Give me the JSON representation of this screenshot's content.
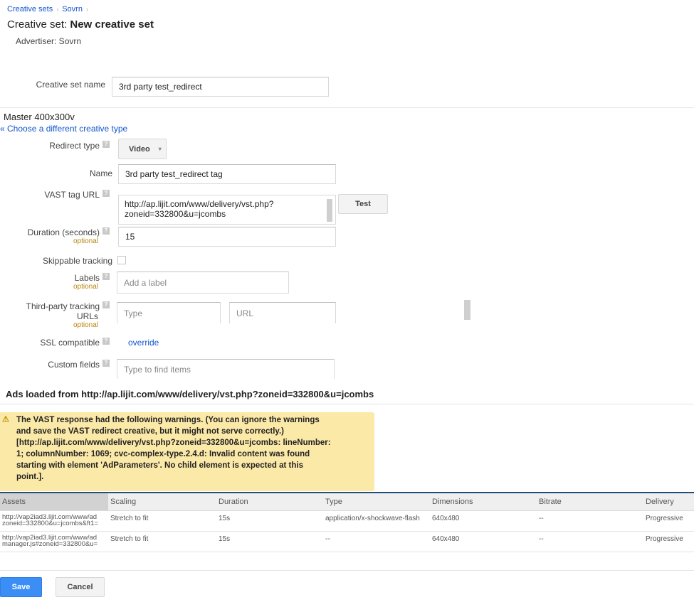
{
  "breadcrumb": [
    {
      "label": "Creative sets"
    },
    {
      "label": "Sovrn"
    }
  ],
  "breadcrumb_separator": "›",
  "page_title": {
    "prefix": "Creative set:",
    "name": "New creative set"
  },
  "advertiser": "Advertiser:  Sovrn",
  "creative_set_name": {
    "label": "Creative set name",
    "value": "3rd party test_redirect"
  },
  "master": {
    "title": "Master 400x300v",
    "choose_link": "« Choose a different creative type"
  },
  "form": {
    "redirect_type": {
      "label": "Redirect type",
      "value": "Video",
      "caret": "▾"
    },
    "name": {
      "label": "Name",
      "value": "3rd party test_redirect tag"
    },
    "vast_tag_url": {
      "label": "VAST tag URL",
      "value_line1": "http://ap.lijit.com/www/delivery/vst.php?",
      "value_line2": "zoneid=332800&u=jcombs",
      "test_button": "Test"
    },
    "duration": {
      "label": "Duration (seconds)",
      "optional": "optional",
      "value": "15"
    },
    "skippable_tracking": {
      "label": "Skippable tracking",
      "checked": false
    },
    "labels": {
      "label": "Labels",
      "optional": "optional",
      "placeholder": "Add a label"
    },
    "third_party": {
      "label_line1": "Third-party tracking",
      "label_line2": "URLs",
      "optional": "optional",
      "type_placeholder": "Type",
      "url_placeholder": "URL"
    },
    "ssl_compatible": {
      "label": "SSL compatible",
      "link": "override"
    },
    "custom_fields": {
      "label": "Custom fields",
      "placeholder": "Type to find items"
    },
    "help_glyph": "?"
  },
  "ads": {
    "title": "Ads loaded from http://ap.lijit.com/www/delivery/vst.php?zoneid=332800&u=jcombs",
    "warning_icon": "⚠",
    "warning_lines": [
      "The VAST response had the following warnings. (You can ignore the warnings",
      "and save the VAST redirect creative, but it might not serve correctly.)",
      "[http://ap.lijit.com/www/delivery/vst.php?zoneid=332800&u=jcombs: lineNumber:",
      "1; columnNumber: 1069; cvc-complex-type.2.4.d: Invalid content was found",
      "starting with element 'AdParameters'. No child element is expected at this",
      "point.]."
    ],
    "columns": [
      "Assets",
      "Scaling",
      "Duration",
      "Type",
      "Dimensions",
      "Bitrate",
      "Delivery"
    ],
    "rows": [
      {
        "asset_line1": "http://vap2iad3.lijit.com/www/ad",
        "asset_line2": "zoneid=332800&u=jcombs&ft1=",
        "scaling": "Stretch to fit",
        "duration": "15s",
        "type": "application/x-shockwave-flash",
        "dimensions": "640x480",
        "bitrate": "--",
        "delivery": "Progressive"
      },
      {
        "asset_line1": "http://vap2iad3.lijit.com/www/ad",
        "asset_line2": "manager.js#zoneid=332800&u=",
        "scaling": "Stretch to fit",
        "duration": "15s",
        "type": "--",
        "dimensions": "640x480",
        "bitrate": "--",
        "delivery": "Progressive"
      }
    ]
  },
  "actions": {
    "save": "Save",
    "cancel": "Cancel"
  }
}
